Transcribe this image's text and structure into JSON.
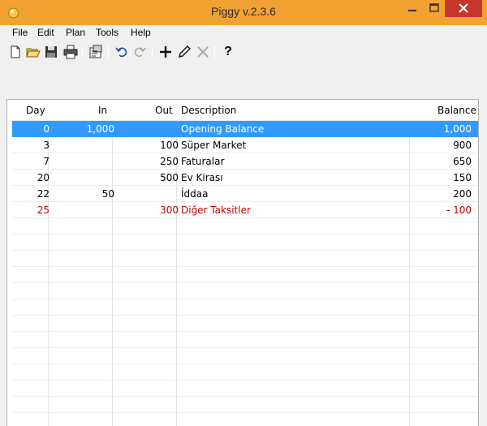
{
  "window": {
    "title": "Piggy v.2.3.6"
  },
  "menu": [
    "File",
    "Edit",
    "Plan",
    "Tools",
    "Help"
  ],
  "toolbar": {
    "buttons": [
      "new-icon",
      "open-icon",
      "save-icon",
      "print-icon",
      "properties-icon",
      "undo-icon",
      "redo-icon",
      "add-icon",
      "edit-icon",
      "delete-icon",
      "help-icon"
    ],
    "help_label": "?"
  },
  "table": {
    "columns": [
      "Day",
      "In",
      "Out",
      "Description",
      "Balance"
    ],
    "rows": [
      {
        "day": "0",
        "in": "1,000",
        "out": "",
        "description": "Opening Balance",
        "balance": "1,000",
        "state": "selected"
      },
      {
        "day": "3",
        "in": "",
        "out": "100",
        "description": "Süper Market",
        "balance": "900",
        "state": "normal"
      },
      {
        "day": "7",
        "in": "",
        "out": "250",
        "description": "Faturalar",
        "balance": "650",
        "state": "normal"
      },
      {
        "day": "20",
        "in": "",
        "out": "500",
        "description": "Ev Kirası",
        "balance": "150",
        "state": "normal"
      },
      {
        "day": "22",
        "in": "50",
        "out": "",
        "description": "İddaa",
        "balance": "200",
        "state": "normal"
      },
      {
        "day": "25",
        "in": "",
        "out": "300",
        "description": "Diğer Taksitler",
        "balance": "- 100",
        "state": "negative"
      }
    ]
  },
  "colors": {
    "titlebar": "#f2a233",
    "selection": "#3399ff",
    "negative": "#c00000",
    "close": "#c7352b"
  }
}
